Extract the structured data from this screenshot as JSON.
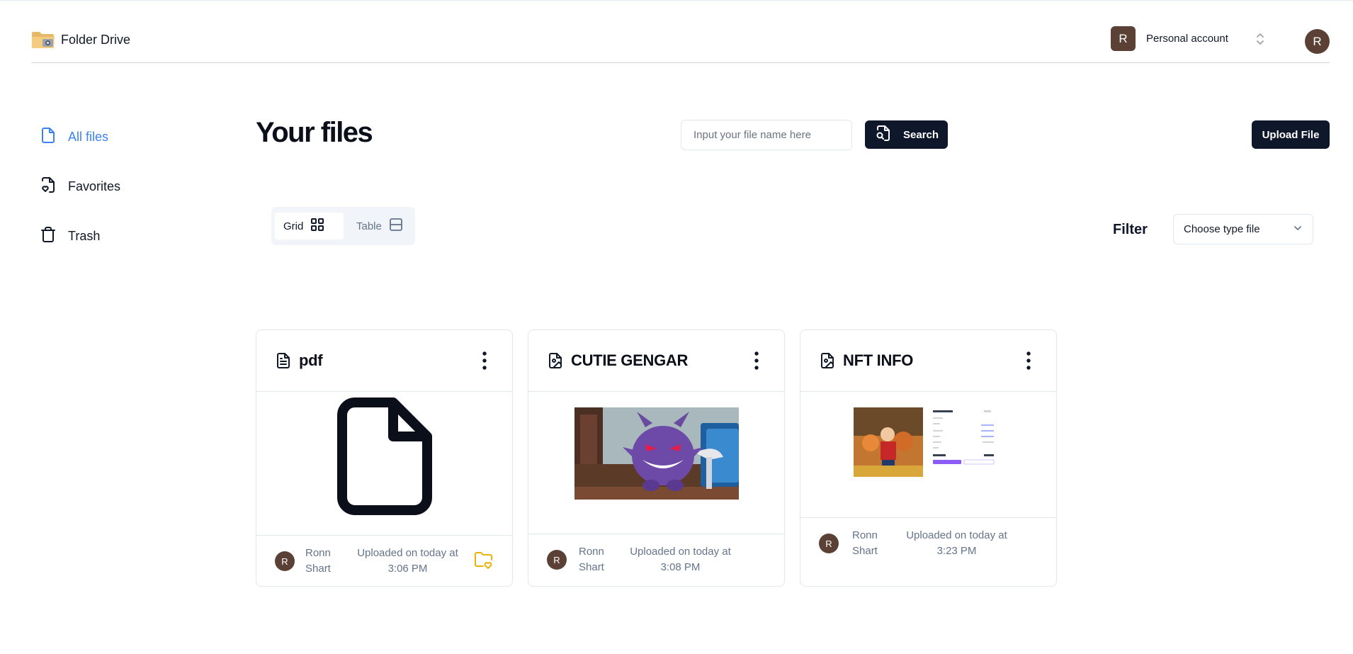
{
  "brand": {
    "name": "Folder Drive",
    "logo_icon": "folder-camera-icon"
  },
  "account": {
    "avatar_letter": "R",
    "name": "Personal account",
    "user_avatar_letter": "R"
  },
  "sidebar": {
    "items": [
      {
        "label": "All files",
        "icon": "file-icon",
        "active": true
      },
      {
        "label": "Favorites",
        "icon": "file-heart-icon",
        "active": false
      },
      {
        "label": "Trash",
        "icon": "trash-icon",
        "active": false
      }
    ]
  },
  "main": {
    "title": "Your files",
    "search": {
      "placeholder": "Input your file name here",
      "button_label": "Search"
    },
    "upload_label": "Upload File",
    "view_toggle": {
      "grid_label": "Grid",
      "table_label": "Table",
      "selected": "Grid"
    },
    "filter": {
      "label": "Filter",
      "placeholder": "Choose type file"
    }
  },
  "files": [
    {
      "title": "pdf",
      "type_icon": "file-text-icon",
      "preview": "file-icon",
      "owner_initial": "R",
      "owner_first": "Ronn",
      "owner_last": "Shart",
      "upload_line1": "Uploaded on today at",
      "upload_line2": "3:06 PM",
      "favorited": true
    },
    {
      "title": "CUTIE GENGAR",
      "type_icon": "file-image-icon",
      "preview": "gengar-image",
      "owner_initial": "R",
      "owner_first": "Ronn",
      "owner_last": "Shart",
      "upload_line1": "Uploaded on today at",
      "upload_line2": "3:08 PM",
      "favorited": false
    },
    {
      "title": "NFT INFO",
      "type_icon": "file-image-icon",
      "preview": "nft-screenshot-image",
      "owner_initial": "R",
      "owner_first": "Ronn",
      "owner_last": "Shart",
      "upload_line1": "Uploaded on today at",
      "upload_line2": "3:23 PM",
      "favorited": false
    }
  ],
  "colors": {
    "accent_active": "#3b82f6",
    "button_dark": "#0f172a",
    "avatar": "#5b4036",
    "favorite": "#eab308"
  }
}
